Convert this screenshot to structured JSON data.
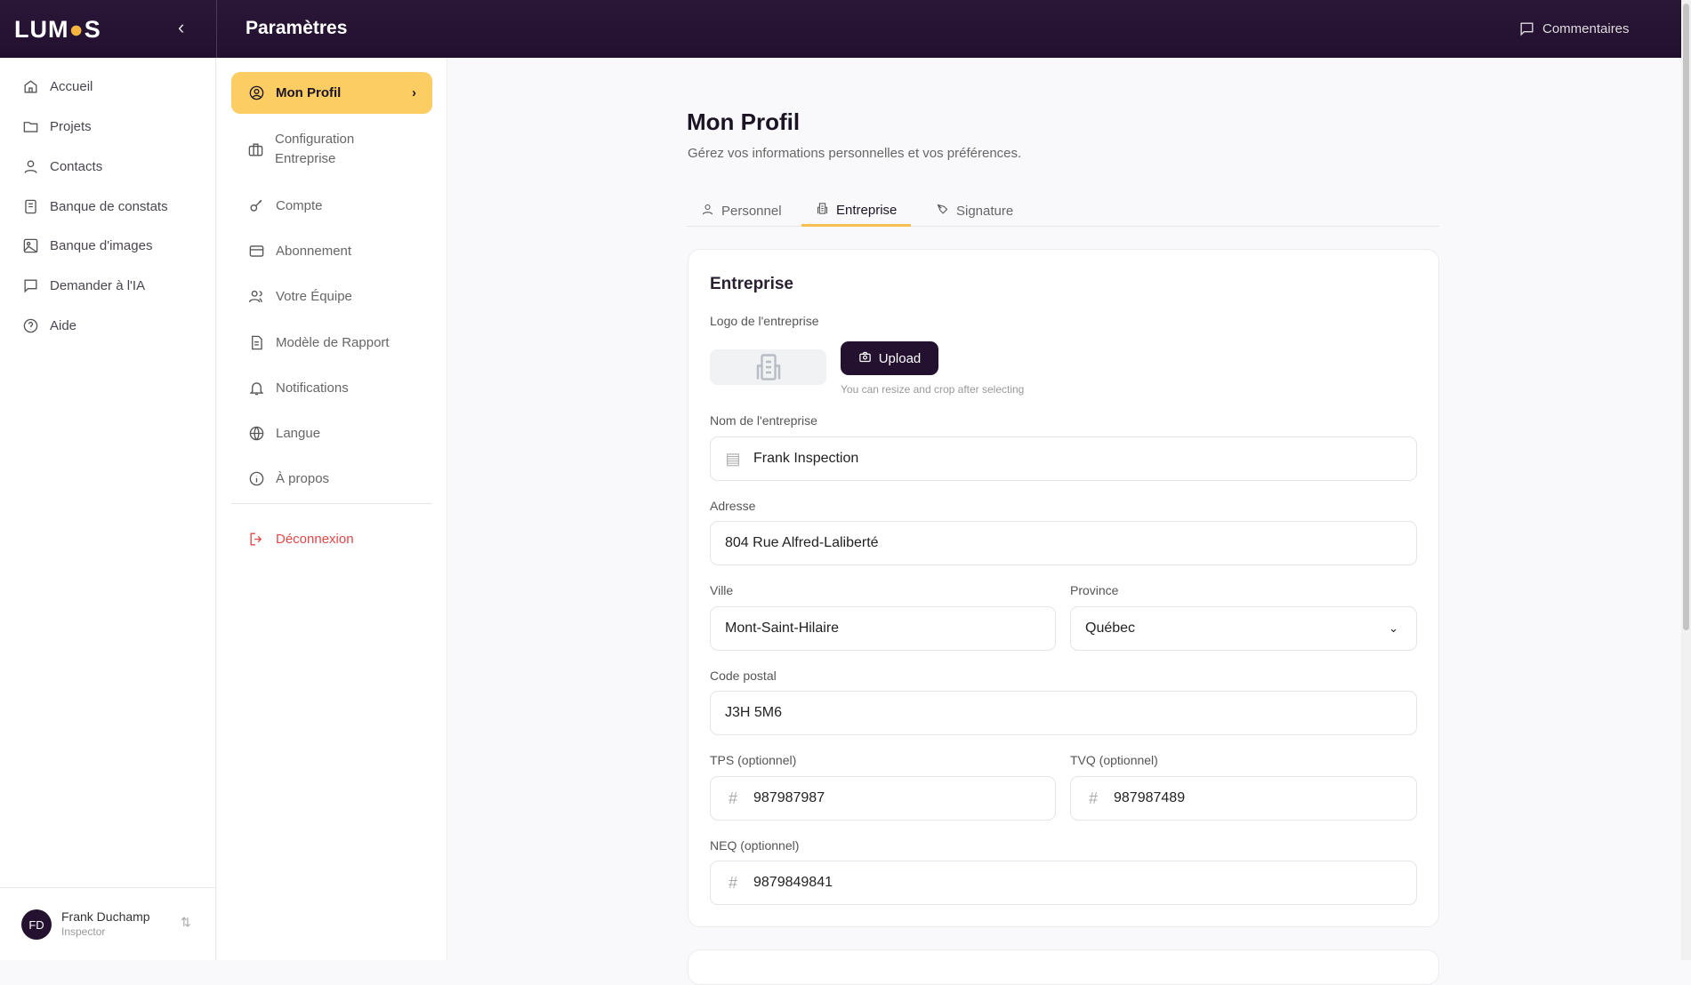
{
  "brand": {
    "logo": "LUMOS",
    "accent": "#fbcd63",
    "dark": "#23112f"
  },
  "header": {
    "title": "Paramètres",
    "comments": "Commentaires"
  },
  "sidebar": {
    "items": [
      {
        "label": "Accueil",
        "icon": "home-icon"
      },
      {
        "label": "Projets",
        "icon": "folder-icon"
      },
      {
        "label": "Contacts",
        "icon": "user-icon"
      },
      {
        "label": "Banque de constats",
        "icon": "book-icon"
      },
      {
        "label": "Banque d'images",
        "icon": "image-icon"
      },
      {
        "label": "Demander à l'IA",
        "icon": "chat-icon"
      },
      {
        "label": "Aide",
        "icon": "help-icon"
      }
    ],
    "user": {
      "initials": "FD",
      "name": "Frank Duchamp",
      "role": "Inspector"
    }
  },
  "settings_nav": {
    "items": [
      {
        "label": "Mon Profil"
      },
      {
        "label": "Configuration Entreprise"
      },
      {
        "label": "Compte"
      },
      {
        "label": "Abonnement"
      },
      {
        "label": "Votre Équipe"
      },
      {
        "label": "Modèle de Rapport"
      },
      {
        "label": "Notifications"
      },
      {
        "label": "Langue"
      },
      {
        "label": "À propos"
      }
    ],
    "logout": "Déconnexion"
  },
  "main": {
    "title": "Mon Profil",
    "subtitle": "Gérez vos informations personnelles et vos préférences.",
    "tabs": [
      {
        "label": "Personnel"
      },
      {
        "label": "Entreprise"
      },
      {
        "label": "Signature"
      }
    ],
    "card": {
      "title": "Entreprise",
      "logo_label": "Logo de l'entreprise",
      "upload": "Upload",
      "upload_hint": "You can resize and crop after selecting",
      "fields": {
        "name": {
          "label": "Nom de l'entreprise",
          "value": "Frank Inspection"
        },
        "address": {
          "label": "Adresse",
          "value": "804 Rue Alfred-Laliberté"
        },
        "city": {
          "label": "Ville",
          "value": "Mont-Saint-Hilaire"
        },
        "province": {
          "label": "Province",
          "value": "Québec"
        },
        "postal": {
          "label": "Code postal",
          "value": "J3H 5M6"
        },
        "tps": {
          "label": "TPS (optionnel)",
          "value": "987987987"
        },
        "tvq": {
          "label": "TVQ (optionnel)",
          "value": "987987489"
        },
        "neq": {
          "label": "NEQ (optionnel)",
          "value": "9879849841"
        }
      }
    }
  }
}
